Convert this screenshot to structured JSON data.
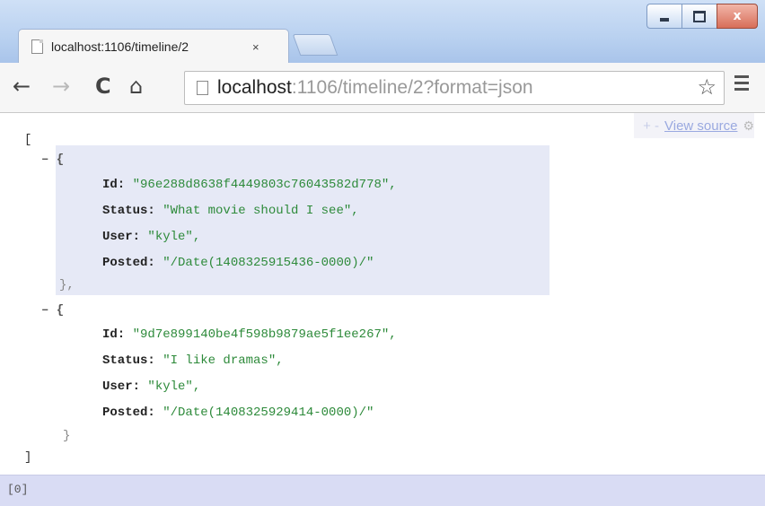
{
  "window": {
    "controls": {
      "min_icon": "minimize-icon",
      "max_icon": "maximize-icon",
      "close_icon": "close-icon",
      "close_glyph": "x"
    }
  },
  "tab": {
    "title": "localhost:1106/timeline/2",
    "close_glyph": "×"
  },
  "toolbar": {
    "back_glyph": "←",
    "forward_glyph": "→",
    "reload_glyph": "C",
    "home_glyph": "⌂",
    "url_host": "localhost",
    "url_rest": ":1106/timeline/2?format=json",
    "star_glyph": "☆"
  },
  "viewer": {
    "pm_glyph": "+ -",
    "view_source": "View source",
    "gear_glyph": "⚙",
    "lines": {
      "open_array": "[",
      "collapse1": "– {",
      "id_key": "Id:",
      "id1": "\"96e288d8638f4449803c76043582d778\",",
      "status_key": "Status:",
      "status1": "\"What movie should I see\",",
      "user_key": "User:",
      "user1": "\"kyle\",",
      "posted_key": "Posted:",
      "posted1": "\"/Date(1408325915436-0000)/\"",
      "close1": "},",
      "collapse2": "– {",
      "id2": "\"9d7e899140be4f598b9879ae5f1ee267\",",
      "status2": "\"I like dramas\",",
      "user2": "\"kyle\",",
      "posted2": "\"/Date(1408325929414-0000)/\"",
      "close2": "}",
      "close_array": "]"
    }
  },
  "statusbar": {
    "path": "[0]"
  },
  "colors": {
    "string": "#2d8a3a",
    "highlight": "#e6e9f6",
    "statusbar": "#d9dcf4"
  }
}
